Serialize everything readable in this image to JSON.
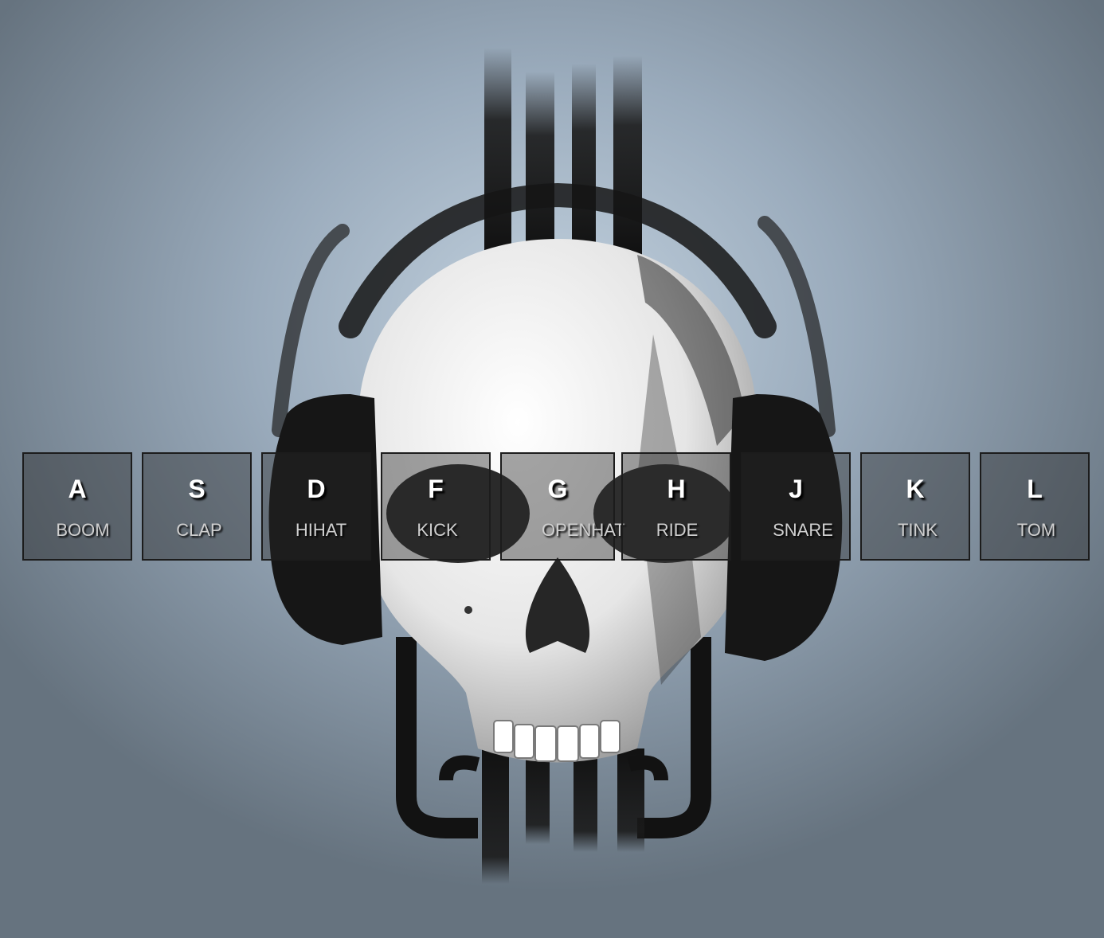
{
  "drum_kit": {
    "keys": [
      {
        "letter": "A",
        "sound": "BOOM"
      },
      {
        "letter": "S",
        "sound": "CLAP"
      },
      {
        "letter": "D",
        "sound": "HIHAT"
      },
      {
        "letter": "F",
        "sound": "KICK"
      },
      {
        "letter": "G",
        "sound": "OPENHAT"
      },
      {
        "letter": "H",
        "sound": "RIDE"
      },
      {
        "letter": "J",
        "sound": "SNARE"
      },
      {
        "letter": "K",
        "sound": "TINK"
      },
      {
        "letter": "L",
        "sound": "TOM"
      }
    ]
  },
  "background": {
    "icon": "skull-with-headphones-image",
    "colors": {
      "backdrop": "#9aabbc",
      "skull": "#f2f2f2",
      "headphones": "#141414"
    }
  }
}
